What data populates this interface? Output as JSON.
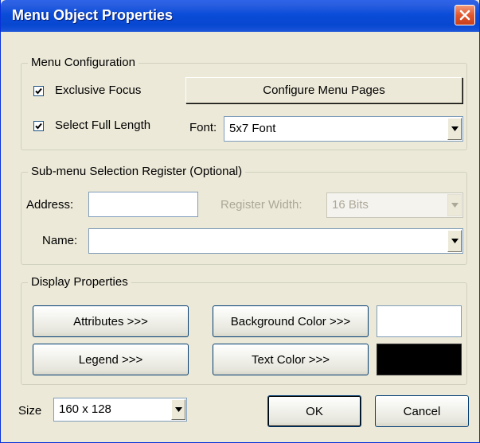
{
  "window": {
    "title": "Menu Object Properties"
  },
  "menu_configuration": {
    "legend": "Menu Configuration",
    "exclusive_focus": {
      "label": "Exclusive Focus",
      "checked": true
    },
    "select_full_length": {
      "label": "Select Full Length",
      "checked": true
    },
    "configure_button": "Configure Menu Pages",
    "font_label": "Font:",
    "font_value": "5x7 Font"
  },
  "submenu_register": {
    "legend": "Sub-menu Selection Register (Optional)",
    "address_label": "Address:",
    "address_value": "",
    "register_width_label": "Register Width:",
    "register_width_value": "16 Bits",
    "name_label": "Name:",
    "name_value": ""
  },
  "display_properties": {
    "legend": "Display Properties",
    "attributes_button": "Attributes >>>",
    "background_color_button": "Background Color >>>",
    "legend_button": "Legend >>>",
    "text_color_button": "Text Color >>>",
    "background_color": "#FFFFFF",
    "text_color": "#000000"
  },
  "footer": {
    "size_label": "Size",
    "size_value": "160 x 128",
    "ok_button": "OK",
    "cancel_button": "Cancel"
  }
}
